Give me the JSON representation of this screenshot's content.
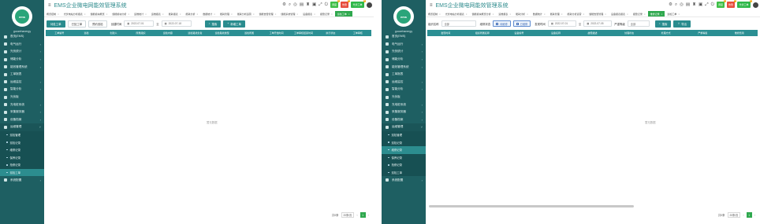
{
  "app": {
    "title": "EMS企业微电网能效管理系统",
    "user": "guozehanergy",
    "logo_text": "ems",
    "colors": {
      "sidebar": "#1e5f62",
      "accent": "#2a8c8e",
      "green": "#2fa84e",
      "red": "#e74c3c"
    }
  },
  "top_icons": [
    "gear-icon",
    "search-icon",
    "fullscreen-icon",
    "lock-icon",
    "bell-icon",
    "screen-icon",
    "expand-icon",
    "power-icon"
  ],
  "badges": {
    "green": {
      "label": "调度",
      "count": "2"
    },
    "red": {
      "label": "告警",
      "count": "7"
    },
    "green2": {
      "label": "光伏工单",
      "count": "3"
    }
  },
  "left": {
    "tabs": [
      {
        "label": "概览控制",
        "active": false
      },
      {
        "label": "光伏电站分析报表",
        "active": false
      },
      {
        "label": "储能模块概览",
        "active": false
      },
      {
        "label": "储能模块分析",
        "active": false
      },
      {
        "label": "运维统计",
        "active": false
      },
      {
        "label": "运维报表",
        "active": false
      },
      {
        "label": "能耗报表",
        "active": false
      },
      {
        "label": "能耗分析",
        "active": false
      },
      {
        "label": "数据统计",
        "active": false
      },
      {
        "label": "能耗管理",
        "active": false
      },
      {
        "label": "能耗分析运营",
        "active": false
      },
      {
        "label": "储能告警管理",
        "active": false
      },
      {
        "label": "储能系统管理",
        "active": false
      },
      {
        "label": "设备报表",
        "active": false
      },
      {
        "label": "报警记录",
        "active": false
      },
      {
        "label": "巡检工单",
        "active": true
      }
    ],
    "filter": {
      "btn_pending": "待处工单",
      "btn_done": "已处工单",
      "btn_plan": "预约巡检",
      "time_label": "创建时间",
      "start": "2022-07-01",
      "sep": "至",
      "end": "2022-07-18",
      "search": "搜索",
      "add": "新增工单"
    },
    "columns": [
      "工单编号",
      "巡检",
      "创建人",
      "所属组织",
      "巡检内容",
      "巡检路线负责",
      "巡检路线类型",
      "巡检所属",
      "工单开始时间",
      "工单审核结束时间",
      "执行状态",
      "工单审核"
    ],
    "empty": "暂无数据",
    "pager": {
      "total": "共0条",
      "page_size": "20条/页",
      "page": "1"
    },
    "menu": [
      {
        "label": "首页(EMS)",
        "type": "item",
        "arrow": ""
      },
      {
        "label": "电气运行",
        "type": "item",
        "arrow": "›"
      },
      {
        "label": "光伏统计",
        "type": "item",
        "arrow": "›"
      },
      {
        "label": "储能分析",
        "type": "item",
        "arrow": "›"
      },
      {
        "label": "能效管理系统",
        "type": "item",
        "arrow": "›"
      },
      {
        "label": "工单报表",
        "type": "item",
        "arrow": ""
      },
      {
        "label": "运维监控",
        "type": "item",
        "arrow": "›"
      },
      {
        "label": "智能分析",
        "type": "item",
        "arrow": "›"
      },
      {
        "label": "光伏板",
        "type": "item",
        "arrow": ""
      },
      {
        "label": "充电桩系统",
        "type": "item",
        "arrow": "›"
      },
      {
        "label": "采集服务器",
        "type": "item",
        "arrow": "›"
      },
      {
        "label": "设备档案",
        "type": "item",
        "arrow": "›"
      },
      {
        "label": "运维管理",
        "type": "open",
        "arrow": "˅"
      },
      {
        "label": "巡检管理",
        "type": "sub",
        "arrow": ""
      },
      {
        "label": "巡检记录",
        "type": "sub",
        "arrow": ""
      },
      {
        "label": "维修记录",
        "type": "sub",
        "arrow": ""
      },
      {
        "label": "保养记录",
        "type": "sub",
        "arrow": ""
      },
      {
        "label": "抢修记录",
        "type": "sub",
        "arrow": ""
      },
      {
        "label": "巡检工单",
        "type": "sub-active",
        "arrow": ""
      },
      {
        "label": "系统配置",
        "type": "item",
        "arrow": "›"
      }
    ]
  },
  "right": {
    "tabs": [
      {
        "label": "概览控制",
        "active": false
      },
      {
        "label": "光伏电站分析报表",
        "active": false
      },
      {
        "label": "储能模块概览分析",
        "active": false
      },
      {
        "label": "运维报表",
        "active": false
      },
      {
        "label": "能耗分析",
        "active": false
      },
      {
        "label": "数据统计",
        "active": false
      },
      {
        "label": "能耗管理",
        "active": false
      },
      {
        "label": "能耗分析运营",
        "active": false
      },
      {
        "label": "储能告警管理",
        "active": false
      },
      {
        "label": "设备报表报表",
        "active": false
      },
      {
        "label": "报警记录",
        "active": false
      },
      {
        "label": "维修记录",
        "active": true
      },
      {
        "label": "巡检工单",
        "active": false
      }
    ],
    "filter": {
      "org_label": "组织名称",
      "org_value": "全部",
      "status_label": "维修状态",
      "chk_pending": "待维修",
      "chk_done": "已维修",
      "time_label": "发现时间",
      "start": "2022-07-01",
      "sep": "至",
      "end": "2022-07-05",
      "severity_label": "严重等级",
      "severity_value": "全部",
      "search": "搜索",
      "add": "导出"
    },
    "columns": [
      "发现时间",
      "组织所属名称",
      "设备编号",
      "设备名称",
      "故障描述",
      "处理状态",
      "处理方式",
      "严重等级",
      "维修费用"
    ],
    "empty": "暂无数据",
    "pager": {
      "total": "共0条",
      "page_size": "20条/页",
      "page": "1"
    },
    "menu": [
      {
        "label": "首页(EMS)",
        "type": "item",
        "arrow": ""
      },
      {
        "label": "电气运行",
        "type": "item",
        "arrow": "›"
      },
      {
        "label": "光伏统计",
        "type": "item",
        "arrow": "›"
      },
      {
        "label": "储能分析",
        "type": "item",
        "arrow": "›"
      },
      {
        "label": "能效管理系统",
        "type": "item",
        "arrow": "›"
      },
      {
        "label": "工单报表",
        "type": "item",
        "arrow": ""
      },
      {
        "label": "运维监控",
        "type": "item",
        "arrow": "›"
      },
      {
        "label": "智能分析",
        "type": "item",
        "arrow": "›"
      },
      {
        "label": "光伏板",
        "type": "item",
        "arrow": ""
      },
      {
        "label": "充电桩系统",
        "type": "item",
        "arrow": "›"
      },
      {
        "label": "采集服务器",
        "type": "item",
        "arrow": "›"
      },
      {
        "label": "设备档案",
        "type": "item",
        "arrow": "›"
      },
      {
        "label": "运维管理",
        "type": "open",
        "arrow": "˅"
      },
      {
        "label": "巡检管理",
        "type": "sub",
        "arrow": ""
      },
      {
        "label": "巡检记录",
        "type": "sub",
        "arrow": ""
      },
      {
        "label": "维修记录",
        "type": "sub-active",
        "arrow": ""
      },
      {
        "label": "保养记录",
        "type": "sub",
        "arrow": ""
      },
      {
        "label": "抢修记录",
        "type": "sub",
        "arrow": ""
      },
      {
        "label": "巡检工单",
        "type": "sub",
        "arrow": ""
      },
      {
        "label": "系统配置",
        "type": "item",
        "arrow": "›"
      }
    ]
  }
}
